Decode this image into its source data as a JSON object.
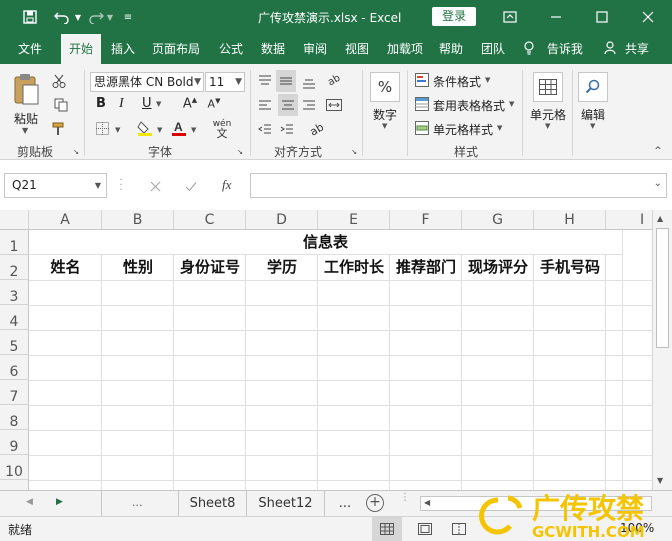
{
  "titlebar": {
    "title": "广传攻禁演示.xlsx  -  Excel",
    "login": "登录"
  },
  "tabs": [
    "文件",
    "开始",
    "插入",
    "页面布局",
    "公式",
    "数据",
    "审阅",
    "视图",
    "加载项",
    "帮助",
    "团队",
    "告诉我",
    "共享"
  ],
  "active_tab": "开始",
  "ribbon": {
    "clipboard": {
      "paste": "粘贴",
      "label": "剪贴板"
    },
    "font": {
      "name": "思源黑体 CN Bold",
      "size": "11",
      "label": "字体",
      "bold": "B",
      "italic": "I",
      "underline": "U"
    },
    "alignment": {
      "label": "对齐方式"
    },
    "number": {
      "button": "数字"
    },
    "styles": {
      "conditional": "条件格式",
      "table": "套用表格格式",
      "cell": "单元格样式",
      "label": "样式"
    },
    "cells": {
      "button": "单元格"
    },
    "editing": {
      "button": "编辑"
    }
  },
  "formula_bar": {
    "name_box": "Q21",
    "fx": "fx",
    "value": ""
  },
  "grid": {
    "columns": [
      "A",
      "B",
      "C",
      "D",
      "E",
      "F",
      "G",
      "H",
      "I"
    ],
    "rows": [
      "1",
      "2",
      "3",
      "4",
      "5",
      "6",
      "7",
      "8",
      "9",
      "10"
    ],
    "title": "信息表",
    "headers": [
      "姓名",
      "性别",
      "身份证号",
      "学历",
      "工作时长",
      "推荐部门",
      "现场评分",
      "手机号码"
    ]
  },
  "sheets": {
    "tabs": [
      "Sheet8",
      "Sheet12"
    ],
    "more": "...",
    "add": "+"
  },
  "status": {
    "ready": "就绪",
    "zoom": "100%"
  },
  "watermark": {
    "text_cn": "广传攻禁",
    "text_en": "GCWITH.COM"
  },
  "colors": {
    "excel_green": "#217346",
    "watermark_yellow": "#f5c400"
  }
}
